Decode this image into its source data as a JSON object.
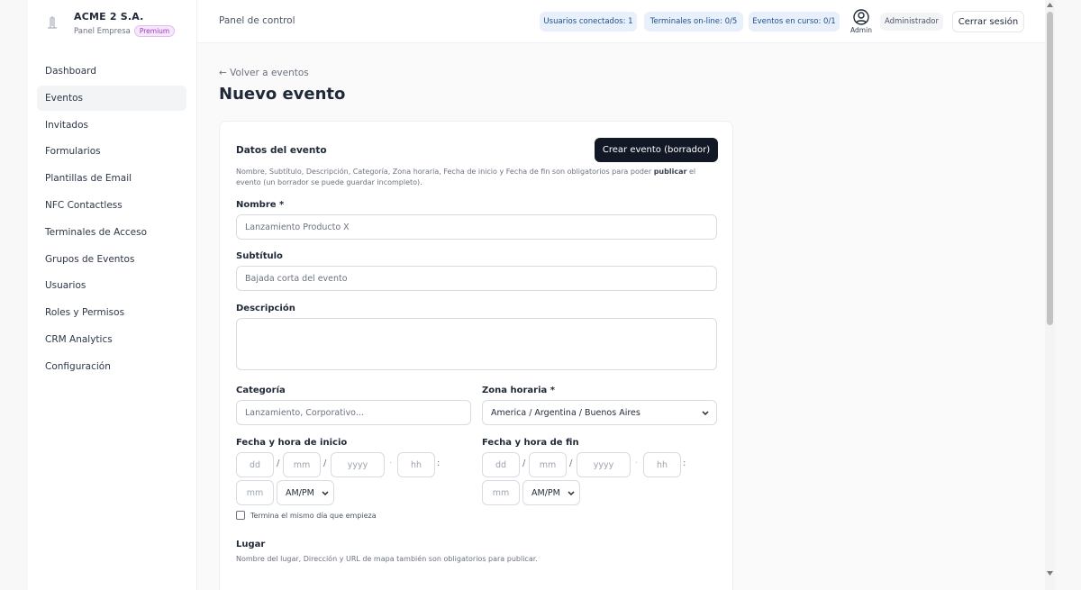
{
  "brand": {
    "name": "ACME 2 S.A.",
    "subtitle": "Panel Empresa",
    "badge": "Premium"
  },
  "sidebar": {
    "items": [
      {
        "label": "Dashboard",
        "active": false
      },
      {
        "label": "Eventos",
        "active": true
      },
      {
        "label": "Invitados",
        "active": false
      },
      {
        "label": "Formularios",
        "active": false
      },
      {
        "label": "Plantillas de Email",
        "active": false
      },
      {
        "label": "NFC Contactless",
        "active": false
      },
      {
        "label": "Terminales de Acceso",
        "active": false
      },
      {
        "label": "Grupos de Eventos",
        "active": false
      },
      {
        "label": "Usuarios",
        "active": false
      },
      {
        "label": "Roles y Permisos",
        "active": false
      },
      {
        "label": "CRM Analytics",
        "active": false
      },
      {
        "label": "Configuración",
        "active": false
      }
    ]
  },
  "header": {
    "title": "Panel de control",
    "chips": [
      "Usuarios conectados: 1",
      "Terminales on-line: 0/5",
      "Eventos en curso: 0/1"
    ],
    "user_label": "Admin",
    "role": "Administrador",
    "logout": "Cerrar sesión"
  },
  "page": {
    "back": "← Volver a eventos",
    "title": "Nuevo evento"
  },
  "form": {
    "section_title": "Datos del evento",
    "submit": "Crear evento (borrador)",
    "help_prefix": "Nombre, Subtítulo, Descripción, Categoría, Zona horaria, Fecha de inicio y Fecha de fin son obligatorios para poder ",
    "help_bold": "publicar",
    "help_suffix": " el evento (un borrador se puede guardar incompleto).",
    "nombre": {
      "label": "Nombre *",
      "placeholder": "Lanzamiento Producto X"
    },
    "subtitulo": {
      "label": "Subtítulo",
      "placeholder": "Bajada corta del evento"
    },
    "descripcion": {
      "label": "Descripción",
      "value": ""
    },
    "categoria": {
      "label": "Categoría",
      "placeholder": "Lanzamiento, Corporativo..."
    },
    "zona": {
      "label": "Zona horaria *",
      "value": "America / Argentina / Buenos Aires"
    },
    "inicio": {
      "label": "Fecha y hora de inicio",
      "dd": "dd",
      "mm": "mm",
      "yyyy": "yyyy",
      "hh": "hh",
      "min": "mm",
      "ampm": "AM/PM"
    },
    "fin": {
      "label": "Fecha y hora de fin",
      "dd": "dd",
      "mm": "mm",
      "yyyy": "yyyy",
      "hh": "hh",
      "min": "mm",
      "ampm": "AM/PM"
    },
    "mismo_dia": "Termina el mismo día que empieza",
    "lugar": {
      "label": "Lugar",
      "help": "Nombre del lugar, Dirección y URL de mapa también son obligatorios para publicar."
    },
    "separators": {
      "slash": "/",
      "dot": "·",
      "colon": ":"
    }
  },
  "colors": {
    "primary_button": "#121826",
    "chip_bg": "#e8f1fb",
    "premium": "#9d3bb8"
  }
}
